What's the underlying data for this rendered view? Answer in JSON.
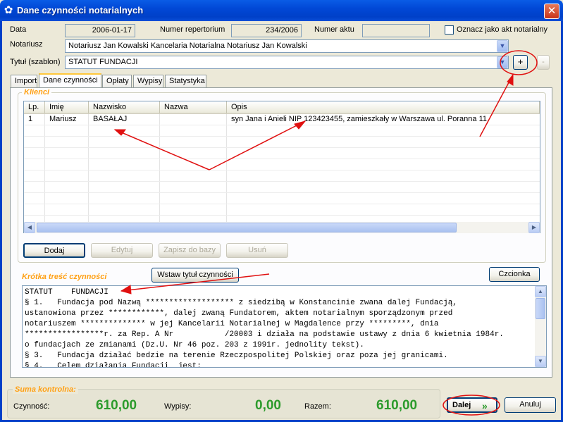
{
  "window": {
    "title": "Dane czynności notarialnych",
    "close": "✕"
  },
  "header": {
    "data_label": "Data",
    "data_value": "2006-01-17",
    "repertorium_label": "Numer repertorium",
    "repertorium_value": "234/2006",
    "akt_label": "Numer aktu",
    "akt_value": "",
    "oznacz_label": "Oznacz jako akt notarialny",
    "notariusz_label": "Notariusz",
    "notariusz_value": "Notariusz Jan Kowalski Kancelaria Notarialna Notariusz Jan Kowalski",
    "tytul_label": "Tytuł (szablon)",
    "tytul_value": "STATUT   FUNDACJI",
    "add_button": "+",
    "remove_button": "-"
  },
  "tabs": [
    {
      "label": "Import"
    },
    {
      "label": "Dane czynności"
    },
    {
      "label": "Opłaty"
    },
    {
      "label": "Wypisy"
    },
    {
      "label": "Statystyka"
    }
  ],
  "klienci": {
    "title": "Klienci",
    "columns": [
      "Lp.",
      "Imię",
      "Nazwisko",
      "Nazwa",
      "Opis"
    ],
    "rows": [
      {
        "lp": "1",
        "imie": "Mariusz",
        "nazwisko": "BASAŁAJ",
        "nazwa": "",
        "opis": "syn Jana i Anieli NIP 123423455, zamieszkały w  Warszawa ul. Poranna 11."
      }
    ],
    "buttons": {
      "dodaj": "Dodaj",
      "edytuj": "Edytuj",
      "zapisz": "Zapisz do bazy",
      "usun": "Usuń"
    }
  },
  "tresc": {
    "title": "Krótka treść czynności",
    "wstaw_button": "Wstaw tytuł czynności",
    "czcionka_button": "Czcionka",
    "lines": [
      "STATUT    FUNDACJI",
      "§ 1.   Fundacja pod Nazwą ******************* z siedzibą w Konstancinie zwana dalej Fundacją,",
      "ustanowiona przez ************, dalej zwaną Fundatorem, aktem notarialnym sporządzonym przed",
      "notariuszem ************** w jej Kancelarii Notarialnej w Magdalence przy *********, dnia",
      "*****************r. za Rep. A Nr           /20003 i działa na podstawie ustawy z dnia 6 kwietnia 1984r.",
      "o fundacjach ze zmianami (Dz.U. Nr 46 poz. 203 z 1991r. jednolity tekst).",
      "§ 3.   Fundacja działać bedzie na terenie Rzeczpospolitej Polskiej oraz poza jej granicami.",
      "§ 4.   Celem działania Fundacji  jest:"
    ]
  },
  "suma": {
    "title": "Suma kontrolna:",
    "czynnosc_label": "Czynność:",
    "czynnosc_value": "610,00",
    "wypisy_label": "Wypisy:",
    "wypisy_value": "0,00",
    "razem_label": "Razem:",
    "razem_value": "610,00"
  },
  "footer": {
    "dalej": "Dalej",
    "anuluj": "Anuluj"
  },
  "colors": {
    "accent_orange": "#ffa014",
    "sum_green": "#2c9b2c",
    "annotation_red": "#e01010",
    "titlebar_blue": "#0040c8"
  }
}
